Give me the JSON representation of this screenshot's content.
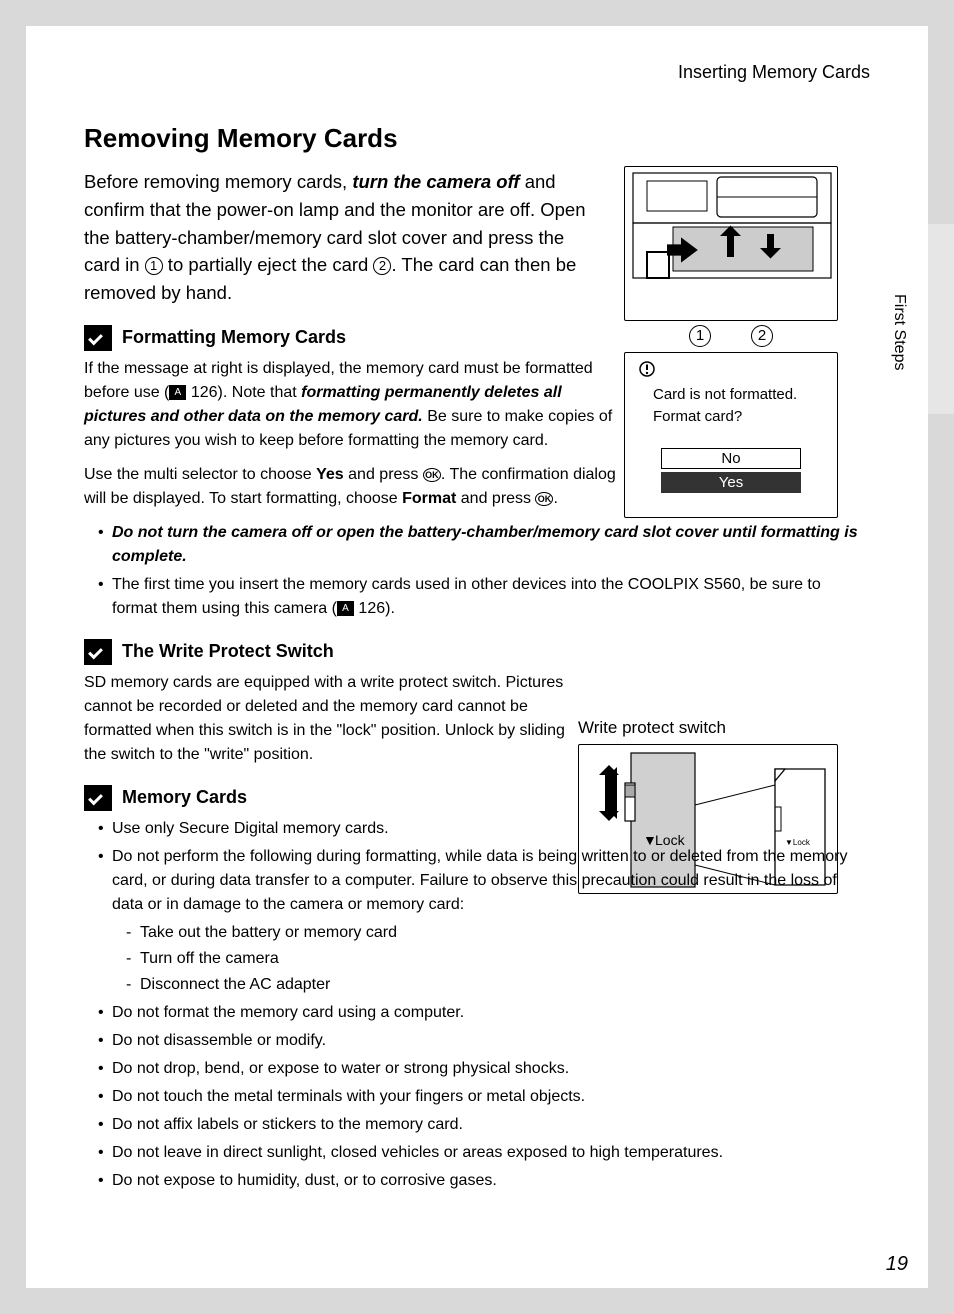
{
  "header": {
    "breadcrumb": "Inserting Memory Cards"
  },
  "sideTab": {
    "label": "First Steps"
  },
  "title": "Removing Memory Cards",
  "intro": {
    "p1a": "Before removing memory cards, ",
    "p1b": "turn the camera off",
    "p1c": " and confirm that the power-on lamp and the monitor are off. Open the battery-chamber/memory card slot cover and press the card in ",
    "p1d": " to partially eject the card ",
    "p1e": ". The card can then be removed by hand.",
    "n1": "1",
    "n2": "2"
  },
  "camLabels": {
    "n1": "1",
    "n2": "2"
  },
  "dialog": {
    "msg1": "Card is not formatted.",
    "msg2": "Format card?",
    "no": "No",
    "yes": "Yes"
  },
  "sec1": {
    "title": "Formatting Memory Cards",
    "p1a": "If the message at right is displayed, the memory card must be formatted before use (",
    "p1ref": "126",
    "p1b": "). Note that ",
    "p1c": "formatting permanently deletes all pictures and other data on the memory card.",
    "p1d": " Be sure to make copies of any pictures you wish to keep before formatting the memory card.",
    "p2a": "Use the multi selector to choose ",
    "p2b": "Yes",
    "p2c": " and press ",
    "p2d": ". The confirmation dialog will be displayed. To start formatting, choose ",
    "p2e": "Format",
    "p2f": " and press ",
    "p2g": ".",
    "ok": "OK",
    "b1": "Do not turn the camera off or open the battery-chamber/memory card slot cover until formatting is complete.",
    "b2a": "The first time you insert the memory cards used in other devices into the COOLPIX S560, be sure to format them using this camera (",
    "b2ref": "126",
    "b2b": ")."
  },
  "sec2": {
    "title": "The Write Protect Switch",
    "p": "SD memory cards are equipped with a write protect switch. Pictures cannot be recorded or deleted and the memory card cannot be formatted when this switch is in the \"lock\" position. Unlock by sliding the switch to the \"write\" position.",
    "figTitle": "Write protect switch",
    "lock": "Lock"
  },
  "sec3": {
    "title": "Memory Cards",
    "b1": "Use only Secure Digital memory cards.",
    "b2": "Do not perform the following during formatting, while data is being written to or deleted from the memory card, or during data transfer to a computer. Failure to observe this precaution could result in the loss of data or in damage to the camera or memory card:",
    "b2d1": "Take out the battery or memory card",
    "b2d2": "Turn off the camera",
    "b2d3": "Disconnect the AC adapter",
    "b3": "Do not format the memory card using a computer.",
    "b4": "Do not disassemble or modify.",
    "b5": "Do not drop, bend, or expose to water or strong physical shocks.",
    "b6": "Do not touch the metal terminals with your fingers or metal objects.",
    "b7": "Do not affix labels or stickers to the memory card.",
    "b8": "Do not leave in direct sunlight, closed vehicles or areas exposed to high temperatures.",
    "b9": "Do not expose to humidity, dust, or to corrosive gases."
  },
  "pageNumber": "19"
}
